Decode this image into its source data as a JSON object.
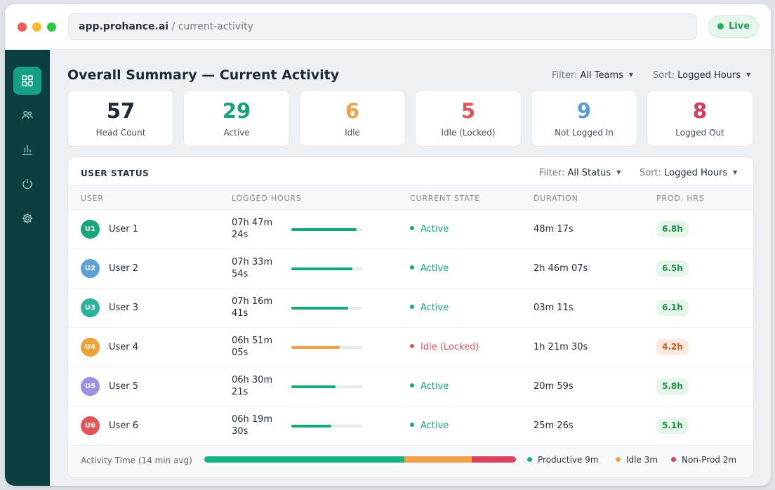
{
  "window": {
    "url_host": "app.prohance.ai",
    "url_path": " / current-activity",
    "live_label": "Live"
  },
  "sidebar": {
    "items": [
      {
        "icon": "dashboard-icon",
        "active": true
      },
      {
        "icon": "users-icon",
        "active": false
      },
      {
        "icon": "bar-chart-icon",
        "active": false
      },
      {
        "icon": "power-icon",
        "active": false
      },
      {
        "icon": "gear-icon",
        "active": false
      }
    ]
  },
  "header": {
    "title": "Overall Summary — Current Activity",
    "filter_label": "Filter:",
    "filter_value": "All Teams",
    "sort_label": "Sort:",
    "sort_value": "Logged Hours"
  },
  "stats": [
    {
      "value": "57",
      "label": "Head Count",
      "color": "#1f2a36"
    },
    {
      "value": "29",
      "label": "Active",
      "color": "#1aa37a"
    },
    {
      "value": "6",
      "label": "Idle",
      "color": "#f0a048"
    },
    {
      "value": "5",
      "label": "Idle (Locked)",
      "color": "#e0575a"
    },
    {
      "value": "9",
      "label": "Not Logged In",
      "color": "#5b9bd5"
    },
    {
      "value": "8",
      "label": "Logged Out",
      "color": "#d43b5a"
    }
  ],
  "user_status": {
    "title": "USER STATUS",
    "filter_label": "Filter:",
    "filter_value": "All Status",
    "sort_label": "Sort:",
    "sort_value": "Logged Hours",
    "columns": [
      "USER",
      "LOGGED HOURS",
      "CURRENT STATE",
      "DURATION",
      "PROD. HRS"
    ],
    "rows": [
      {
        "initials": "U1",
        "name": "User 1",
        "hours_line1": "07h 47m",
        "hours_line2": "24s",
        "progress": 0.92,
        "bar_color": "#16a77c",
        "state": "Active",
        "state_color": "#16a77c",
        "duration": "48m 17s",
        "prod": "6.8h",
        "prod_kind": "good",
        "avatar_color": "#16a77c"
      },
      {
        "initials": "U2",
        "name": "User 2",
        "hours_line1": "07h 33m",
        "hours_line2": "54s",
        "progress": 0.86,
        "bar_color": "#16a77c",
        "state": "Active",
        "state_color": "#16a77c",
        "duration": "2h 46m 07s",
        "prod": "6.5h",
        "prod_kind": "good",
        "avatar_color": "#5ea1d6"
      },
      {
        "initials": "U3",
        "name": "User 3",
        "hours_line1": "07h 16m",
        "hours_line2": "41s",
        "progress": 0.8,
        "bar_color": "#16a77c",
        "state": "Active",
        "state_color": "#16a77c",
        "duration": "03m 11s",
        "prod": "6.1h",
        "prod_kind": "good",
        "avatar_color": "#2bb39a"
      },
      {
        "initials": "U4",
        "name": "User 4",
        "hours_line1": "06h 51m",
        "hours_line2": "05s",
        "progress": 0.68,
        "bar_color": "#f0a048",
        "state": "Idle (Locked)",
        "state_color": "#e0575a",
        "duration": "1h 21m 30s",
        "prod": "4.2h",
        "prod_kind": "warn",
        "avatar_color": "#eea23a"
      },
      {
        "initials": "U5",
        "name": "User 5",
        "hours_line1": "06h 30m",
        "hours_line2": "21s",
        "progress": 0.62,
        "bar_color": "#16a77c",
        "state": "Active",
        "state_color": "#16a77c",
        "duration": "20m 59s",
        "prod": "5.8h",
        "prod_kind": "good",
        "avatar_color": "#9b8fe6"
      },
      {
        "initials": "U6",
        "name": "User 6",
        "hours_line1": "06h 19m",
        "hours_line2": "30s",
        "progress": 0.56,
        "bar_color": "#16a77c",
        "state": "Active",
        "state_color": "#16a77c",
        "duration": "25m 26s",
        "prod": "5.1h",
        "prod_kind": "good",
        "avatar_color": "#e05555"
      }
    ]
  },
  "activity": {
    "label": "Activity Time (14 min avg)",
    "segments": [
      {
        "name": "Productive",
        "minutes": 9,
        "legend": "Productive 9m",
        "color": "#16b184"
      },
      {
        "name": "Idle",
        "minutes": 3,
        "legend": "Idle 3m",
        "color": "#f0a048"
      },
      {
        "name": "Non-Prod",
        "minutes": 2,
        "legend": "Non-Prod 2m",
        "color": "#d9435f"
      }
    ]
  }
}
